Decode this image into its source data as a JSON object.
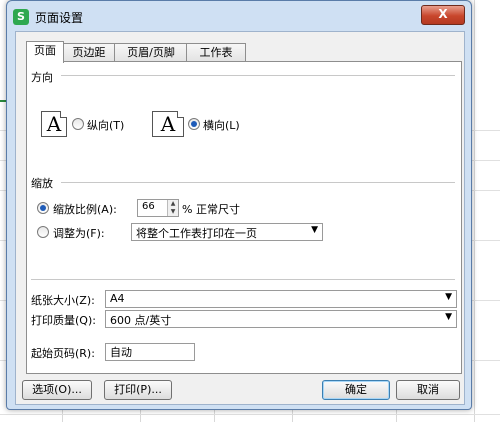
{
  "dialog": {
    "title": "页面设置",
    "app_icon_letter": "S",
    "close_glyph": "X"
  },
  "tabs": [
    {
      "label": "页面",
      "active": true
    },
    {
      "label": "页边距",
      "active": false
    },
    {
      "label": "页眉/页脚",
      "active": false
    },
    {
      "label": "工作表",
      "active": false
    }
  ],
  "orientation": {
    "group_label": "方向",
    "portrait_label": "纵向(T)",
    "landscape_label": "横向(L)",
    "selected": "landscape",
    "glyph": "A"
  },
  "scaling": {
    "group_label": "缩放",
    "scale_label": "缩放比例(A):",
    "scale_value": "66",
    "scale_suffix": "% 正常尺寸",
    "fit_label": "调整为(F):",
    "fit_option": "将整个工作表打印在一页",
    "selected": "scale"
  },
  "paper": {
    "size_label": "纸张大小(Z):",
    "size_value": "A4",
    "quality_label": "打印质量(Q):",
    "quality_value": "600 点/英寸",
    "first_page_label": "起始页码(R):",
    "first_page_value": "自动"
  },
  "buttons": {
    "options": "选项(O)...",
    "print": "打印(P)...",
    "ok": "确定",
    "cancel": "取消"
  },
  "colors": {
    "accent": "#1e5bb8",
    "frame": "#cfe0f3",
    "close": "#c8462c"
  }
}
